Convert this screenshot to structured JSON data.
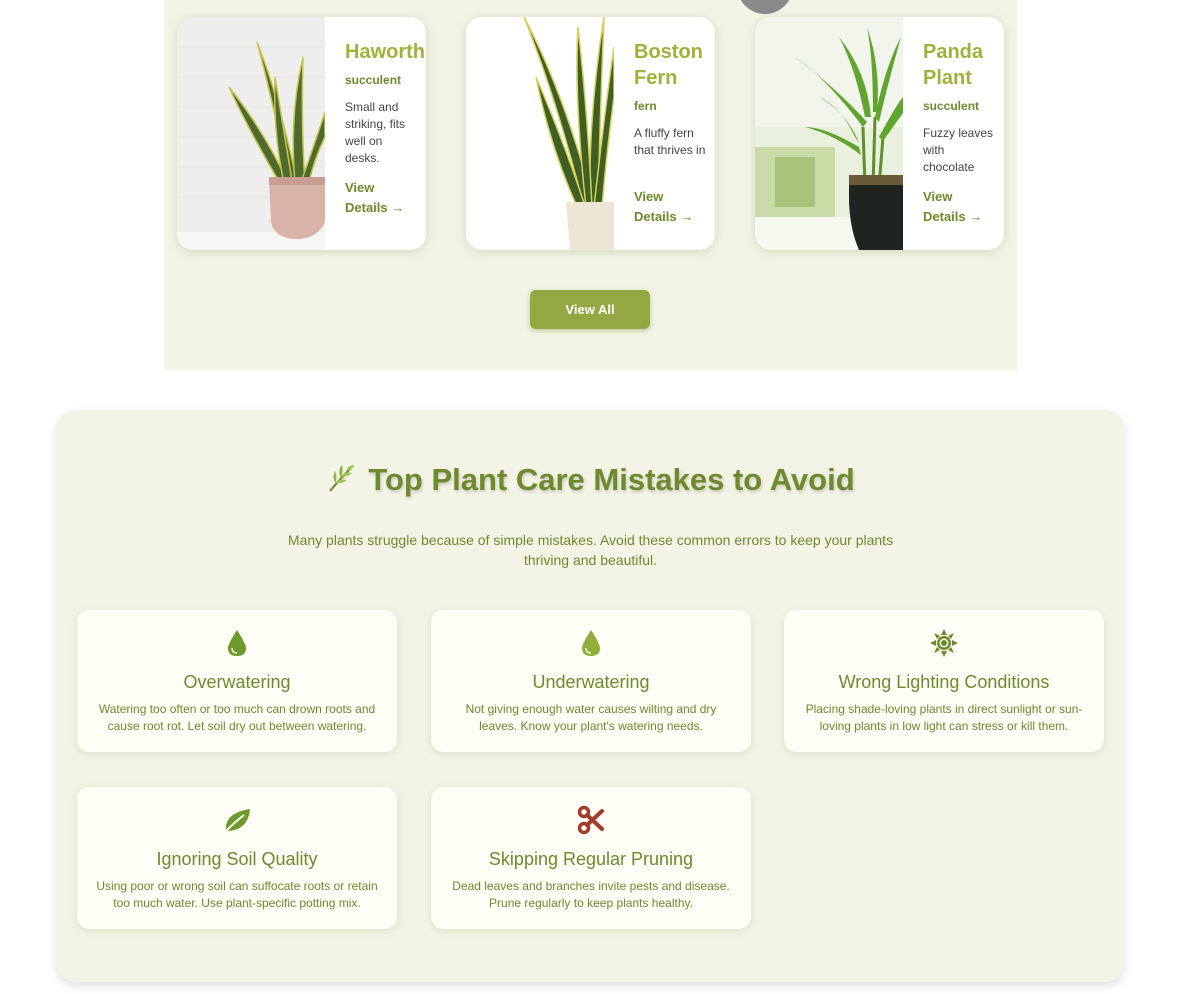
{
  "plants": {
    "cards": [
      {
        "title": "Haworthia",
        "category": "succulent",
        "description": "Small and striking, fits well on desks.",
        "link": "View Details →",
        "image": "snake-plant-pink-pot"
      },
      {
        "title": "Boston Fern",
        "category": "fern",
        "description": "A fluffy fern that thrives in",
        "link": "View Details →",
        "image": "snake-plant-white-pot"
      },
      {
        "title": "Panda Plant",
        "category": "succulent",
        "description": "Fuzzy leaves with chocolate",
        "link": "View Details →",
        "image": "lucky-bamboo-black-pot"
      }
    ],
    "view_all_label": "View All"
  },
  "mistakes": {
    "title": "Top Plant Care Mistakes to Avoid",
    "title_icon": "herb-icon",
    "subtitle": "Many plants struggle because of simple mistakes. Avoid these common errors to keep your plants thriving and beautiful.",
    "items": [
      {
        "icon": "water-drop-icon",
        "title": "Overwatering",
        "text": "Watering too often or too much can drown roots and cause root rot. Let soil dry out between watering."
      },
      {
        "icon": "water-drop-icon",
        "title": "Underwatering",
        "text": "Not giving enough water causes wilting and dry leaves. Know your plant's watering needs."
      },
      {
        "icon": "sun-icon",
        "title": "Wrong Lighting Conditions",
        "text": "Placing shade-loving plants in direct sunlight or sun-loving plants in low light can stress or kill them."
      },
      {
        "icon": "leaf-icon",
        "title": "Ignoring Soil Quality",
        "text": "Using poor or wrong soil can suffocate roots or retain too much water. Use plant-specific potting mix."
      },
      {
        "icon": "scissors-icon",
        "title": "Skipping Regular Pruning",
        "text": "Dead leaves and branches invite pests and disease. Prune regularly to keep plants healthy."
      }
    ]
  },
  "colors": {
    "accent": "#6d8a2c",
    "title_green": "#a1b13a",
    "button": "#93a842",
    "section_bg": "#f3f4e6",
    "scissors": "#a33a2a"
  }
}
